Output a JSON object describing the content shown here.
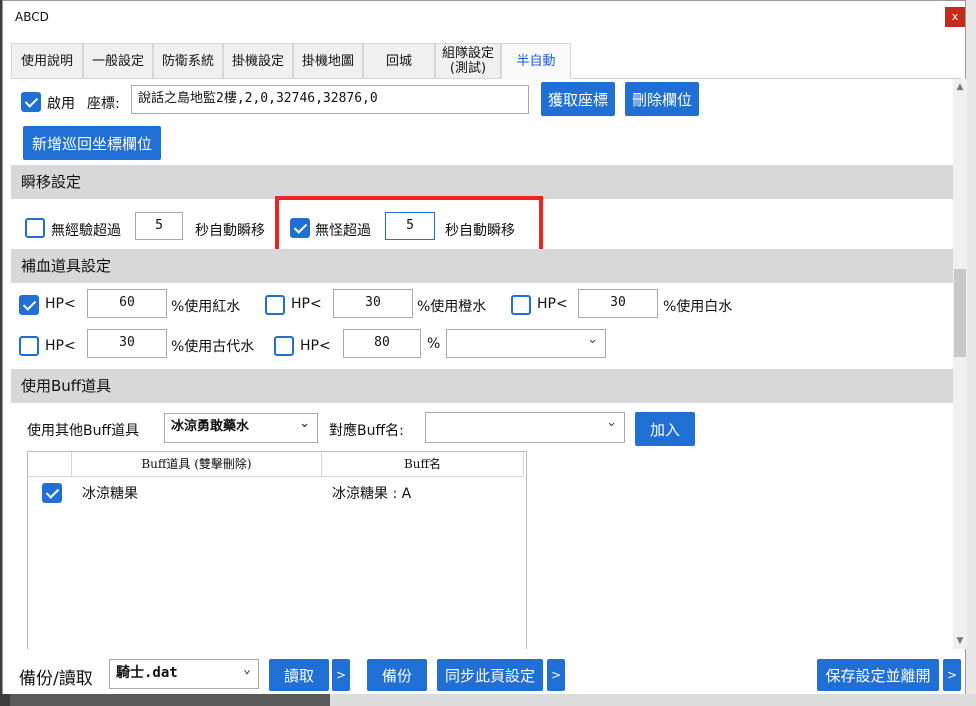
{
  "window": {
    "title": "ABCD",
    "close_label": "x"
  },
  "tabs": [
    {
      "label": "使用說明"
    },
    {
      "label": "一般設定"
    },
    {
      "label": "防衛系統"
    },
    {
      "label": "掛機設定"
    },
    {
      "label": "掛機地圖"
    },
    {
      "label": "回城"
    },
    {
      "label": "組隊設定\n(測試)"
    },
    {
      "label": "半自動"
    }
  ],
  "top_row": {
    "enable_label": "啟用",
    "enable_checked": true,
    "coord_label": "座標:",
    "coord_value": "說話之島地監2樓,2,0,32746,32876,0",
    "get_coord_button": "獲取座標",
    "delete_field_button": "刪除欄位",
    "add_patrol_button": "新增巡回坐標欄位"
  },
  "teleport": {
    "header": "瞬移設定",
    "no_exp_label": "無經驗超過",
    "no_exp_checked": false,
    "no_exp_value": "5",
    "no_exp_suffix": "秒自動瞬移",
    "no_monster_label": "無怪超過",
    "no_monster_checked": true,
    "no_monster_value": "5",
    "no_monster_suffix": "秒自動瞬移"
  },
  "potion": {
    "header": "補血道具設定",
    "rows": [
      {
        "checked": true,
        "prefix": "HP<",
        "value": "60",
        "suffix": "%使用紅水"
      },
      {
        "checked": false,
        "prefix": "HP<",
        "value": "30",
        "suffix": "%使用橙水"
      },
      {
        "checked": false,
        "prefix": "HP<",
        "value": "30",
        "suffix": "%使用白水"
      },
      {
        "checked": false,
        "prefix": "HP<",
        "value": "30",
        "suffix": "%使用古代水"
      },
      {
        "checked": false,
        "prefix": "HP<",
        "value": "80",
        "suffix": "%"
      }
    ],
    "extra_select_value": ""
  },
  "buff": {
    "header": "使用Buff道具",
    "other_label": "使用其他Buff道具",
    "other_select_value": "冰涼勇敢藥水",
    "match_label": "對應Buff名:",
    "match_select_value": "",
    "add_button": "加入",
    "columns": [
      "Buff道具 (雙擊刪除)",
      "Buff名"
    ],
    "rows": [
      {
        "checked": true,
        "item": "冰涼糖果",
        "buff": "冰涼糖果 : A"
      }
    ]
  },
  "footer": {
    "backup_label": "備份/讀取",
    "file_value": "騎士.dat",
    "read_button": "讀取",
    "more_glyph": ">",
    "backup_button": "備份",
    "sync_button": "同步此頁設定",
    "save_exit_button": "保存設定並離開"
  },
  "colors": {
    "accent": "#1f6fd4",
    "highlight": "#ec2424",
    "section_bg": "#d8d8d8"
  }
}
